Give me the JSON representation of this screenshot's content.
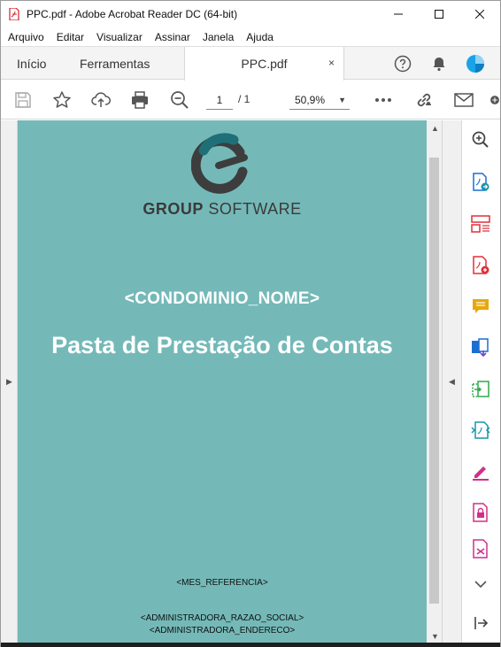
{
  "window": {
    "title": "PPC.pdf - Adobe Acrobat Reader DC (64-bit)"
  },
  "menu": [
    "Arquivo",
    "Editar",
    "Visualizar",
    "Assinar",
    "Janela",
    "Ajuda"
  ],
  "tabs": {
    "home": "Início",
    "tools": "Ferramentas",
    "document": "PPC.pdf",
    "close": "×"
  },
  "toolbar": {
    "page_current": "1",
    "page_total": "/ 1",
    "zoom": "50,9%"
  },
  "document": {
    "brand_bold": "GROUP",
    "brand_light": " SOFTWARE",
    "condominio": "<CONDOMINIO_NOME>",
    "title": "Pasta de Prestação de Contas",
    "mes_referencia": "<MES_REFERENCIA>",
    "razao_social": "<ADMINISTRADORA_RAZAO_SOCIAL>",
    "endereco": "<ADMINISTRADORA_ENDERECO>"
  },
  "colors": {
    "page_background": "#74b9b8",
    "tool_blue": "#1c6fd1",
    "tool_red": "#e0303a",
    "tool_yellow": "#e8a80c",
    "tool_green": "#2ea84a",
    "tool_teal": "#1896a8",
    "tool_pink": "#d0308a"
  },
  "icons": [
    "save-icon",
    "star-icon",
    "upload-icon",
    "print-icon",
    "zoom-out-icon",
    "more-icon",
    "link-icon",
    "mail-icon",
    "help-icon",
    "bell-icon",
    "account-icon"
  ]
}
